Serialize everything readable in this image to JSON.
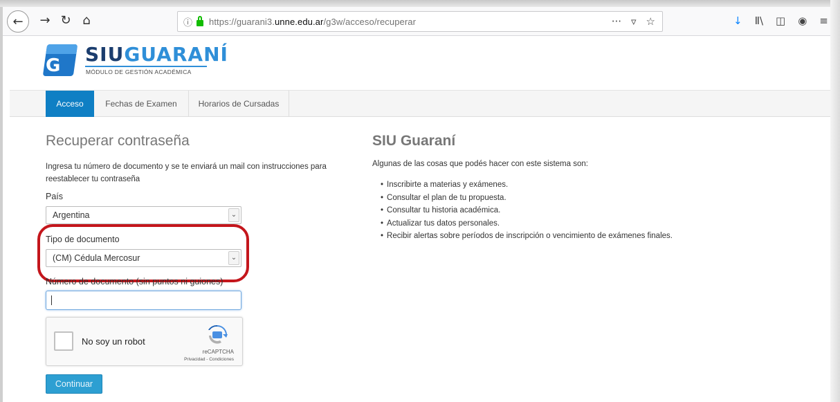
{
  "browser": {
    "url_prefix": "https://guarani3.",
    "url_domain": "unne.edu.ar",
    "url_path": "/g3w/acceso/recuperar",
    "back_glyph": "←",
    "forward_glyph": "→",
    "reload_glyph": "↻",
    "home_glyph": "⌂",
    "info_glyph": "ⓘ",
    "more_glyph": "···",
    "pocket_glyph": "▿",
    "star_glyph": "☆",
    "download_glyph": "↓",
    "library_glyph": "Ⅱ\\",
    "sidebar_glyph": "◫",
    "account_glyph": "◉",
    "menu_glyph": "≡"
  },
  "header": {
    "logo_siu": "SIU",
    "logo_guarani": "GUARANÍ",
    "logo_subtitle": "MÓDULO DE GESTIÓN ACADÉMICA",
    "logo_letter": "G"
  },
  "nav": {
    "acceso": "Acceso",
    "fechas": "Fechas de Examen",
    "horarios": "Horarios de Cursadas"
  },
  "form": {
    "title": "Recuperar contraseña",
    "intro": "Ingresa tu número de documento y se te enviará un mail con instrucciones para reestablecer tu contraseña",
    "pais_label": "País",
    "pais_value": "Argentina",
    "tipo_label": "Tipo de documento",
    "tipo_value": "(CM) Cédula Mercosur",
    "numero_label": "Número de documento (sin puntos ni guiones)",
    "numero_value": "",
    "captcha_text": "No soy un robot",
    "captcha_brand": "reCAPTCHA",
    "captcha_links": "Privacidad - Condiciones",
    "submit": "Continuar",
    "arrow_glyph": "⌄"
  },
  "info": {
    "title": "SIU Guaraní",
    "intro": "Algunas de las cosas que podés hacer con este sistema son:",
    "items": [
      "Inscribirte a materias y exámenes.",
      "Consultar el plan de tu propuesta.",
      "Consultar tu historia académica.",
      "Actualizar tus datos personales.",
      "Recibir alertas sobre períodos de inscripción o vencimiento de exámenes finales."
    ]
  },
  "colors": {
    "accent": "#0f7fc4",
    "highlight": "#c4161c",
    "button": "#2d9fd2"
  }
}
